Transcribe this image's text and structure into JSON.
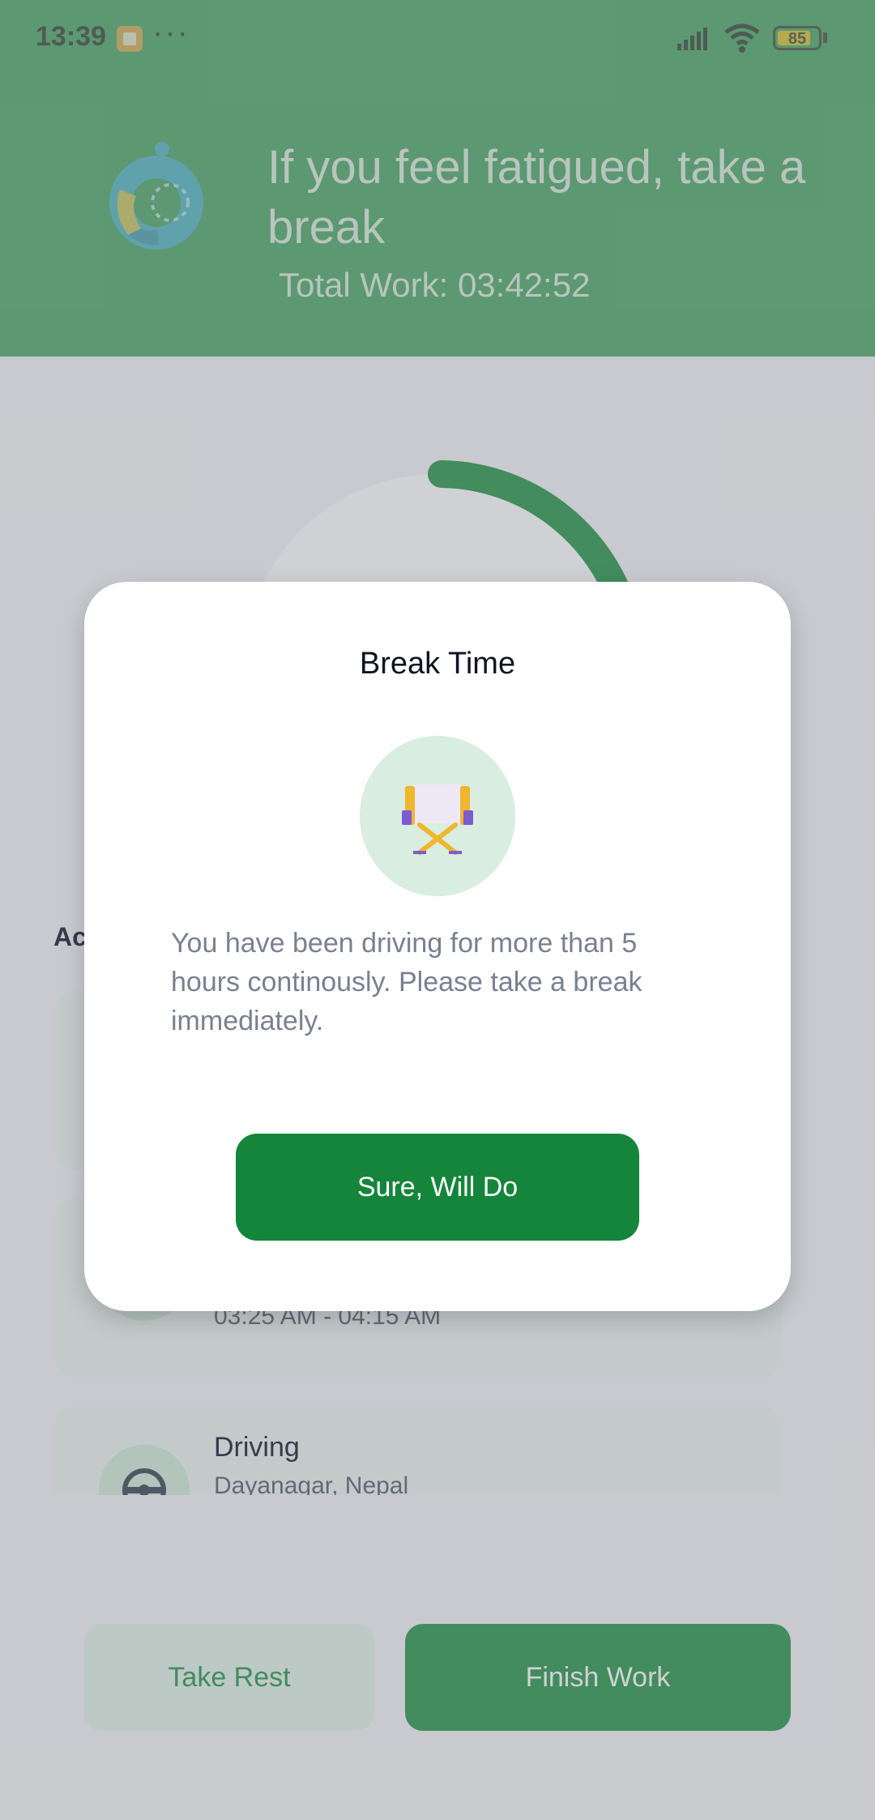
{
  "status_bar": {
    "time": "13:39",
    "more": "···",
    "battery_level": "85",
    "icons": [
      "notification-icon",
      "signal-icon",
      "wifi-icon",
      "battery-icon"
    ]
  },
  "header": {
    "title": "If you feel fatigued, take a break",
    "total_work": "Total Work: 03:42:52",
    "icon": "timer-ring-icon"
  },
  "activities": {
    "section_title": "Ac",
    "cards": [
      {
        "title": "",
        "subtitle": ""
      },
      {
        "title": "",
        "subtitle": "03:25 AM - 04:15 AM"
      },
      {
        "title": "Driving",
        "subtitle": "Dayanagar, Nepal",
        "icon": "steering-wheel-icon"
      }
    ]
  },
  "footer": {
    "take_rest": "Take Rest",
    "finish_work": "Finish Work"
  },
  "dialog": {
    "title": "Break Time",
    "icon": "director-chair-icon",
    "message": "You have been driving for more than 5 hours continously. Please take a break immediately.",
    "confirm_button": "Sure, Will Do"
  },
  "colors": {
    "primary_green": "#2f9a52",
    "dialog_button_green": "#14853a",
    "light_green": "#d9ede0",
    "scrim": "rgba(110,113,120,0.32)"
  }
}
